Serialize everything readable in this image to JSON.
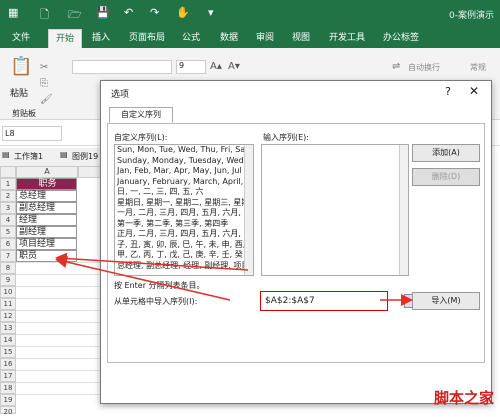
{
  "window": {
    "title": "0-案例演示"
  },
  "ribbon_tabs": [
    {
      "label": "文件"
    },
    {
      "label": "开始"
    },
    {
      "label": "插入"
    },
    {
      "label": "页面布局"
    },
    {
      "label": "公式"
    },
    {
      "label": "数据"
    },
    {
      "label": "审阅"
    },
    {
      "label": "视图"
    },
    {
      "label": "开发工具"
    },
    {
      "label": "办公标签"
    }
  ],
  "ribbon": {
    "paste": "粘贴",
    "clipboard": "剪贴板",
    "font_size": "9",
    "wrap": "自动换行",
    "normal": "常规"
  },
  "namebox": "L8",
  "workbook_tabs": [
    "工作簿1",
    "图例19"
  ],
  "sheet": {
    "col_header": "A",
    "rows": [
      "1",
      "2",
      "3",
      "4",
      "5",
      "6",
      "7",
      "8",
      "9",
      "10",
      "11",
      "12",
      "13",
      "14",
      "15",
      "16",
      "17",
      "18",
      "19",
      "20"
    ],
    "cells": [
      "职务",
      "总经理",
      "副总经理",
      "经理",
      "副经理",
      "项目经理",
      "职员"
    ]
  },
  "dialog": {
    "title": "选项",
    "help": "?",
    "close": "✕",
    "tab": "自定义序列",
    "list_label": "自定义序列(L):",
    "input_label": "输入序列(E):",
    "list": [
      "Sun, Mon, Tue, Wed, Thu, Fri, Sat",
      "Sunday, Monday, Tuesday, Wedn",
      "Jan, Feb, Mar, Apr, May, Jun, Jul",
      "January, February, March, April, M",
      "日, 一, 二, 三, 四, 五, 六",
      "星期日, 星期一, 星期二, 星期三, 星期",
      "一月, 二月, 三月, 四月, 五月, 六月, 七",
      "第一季, 第二季, 第三季, 第四季",
      "正月, 二月, 三月, 四月, 五月, 六月, 七",
      "子, 丑, 寅, 卯, 辰, 巳, 午, 未, 申, 酉, 戌",
      "甲, 乙, 丙, 丁, 戊, 己, 庚, 辛, 壬, 癸",
      "总经理, 副总经理, 经理, 副经理, 项目"
    ],
    "add": "添加(A)",
    "delete": "删除(D)",
    "hint": "按 Enter 分隔列表条目。",
    "import_label": "从单元格中导入序列(I):",
    "range": "$A$2:$A$7",
    "import": "导入(M)"
  },
  "watermark": "脚本之家",
  "colors": {
    "excel_green": "#217346",
    "header_fill": "#8b2350",
    "annotation_red": "#e0302a"
  }
}
